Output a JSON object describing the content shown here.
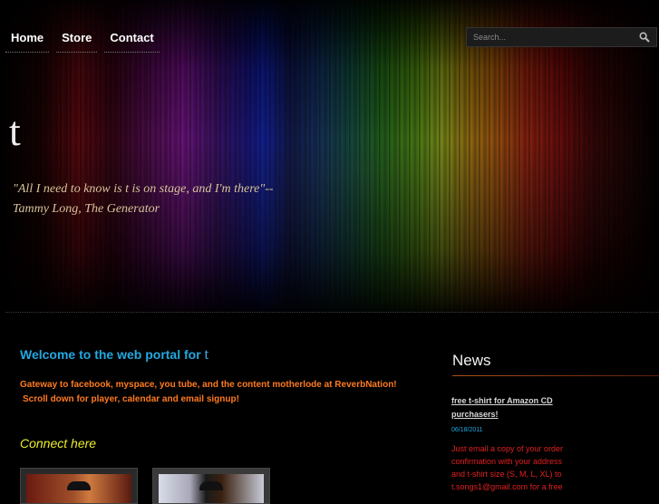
{
  "nav": {
    "items": [
      {
        "label": "Home"
      },
      {
        "label": "Store"
      },
      {
        "label": "Contact"
      }
    ]
  },
  "search": {
    "placeholder": "Search..."
  },
  "header": {
    "site_title": "t",
    "quote": "\"All I need to know is t is on stage, and I'm there\"-- Tammy Long, The Generator"
  },
  "main": {
    "welcome": "Welcome to the web portal for ",
    "welcome_name": "t",
    "intro_line1": "Gateway to facebook, myspace, you tube, and the content motherlode at ReverbNation!",
    "intro_line2": "Scroll down for player, calendar and email signup!",
    "connect": "Connect here"
  },
  "news": {
    "title": "News",
    "item_title": "free t-shirt for Amazon CD purchasers!",
    "item_date": "06/18/2011",
    "item_body": "Just email a copy of your order confirmation with your address and t-shirt size (S, M, L, XL) to t.songs1@gmail.com for a free"
  },
  "icons": {
    "search": "magnifier-icon"
  },
  "colors": {
    "welcome": "#22a8e0",
    "intro": "#ff7a20",
    "connect": "#ecec2a",
    "news_body": "#e02020",
    "quote": "#d8c39a"
  }
}
